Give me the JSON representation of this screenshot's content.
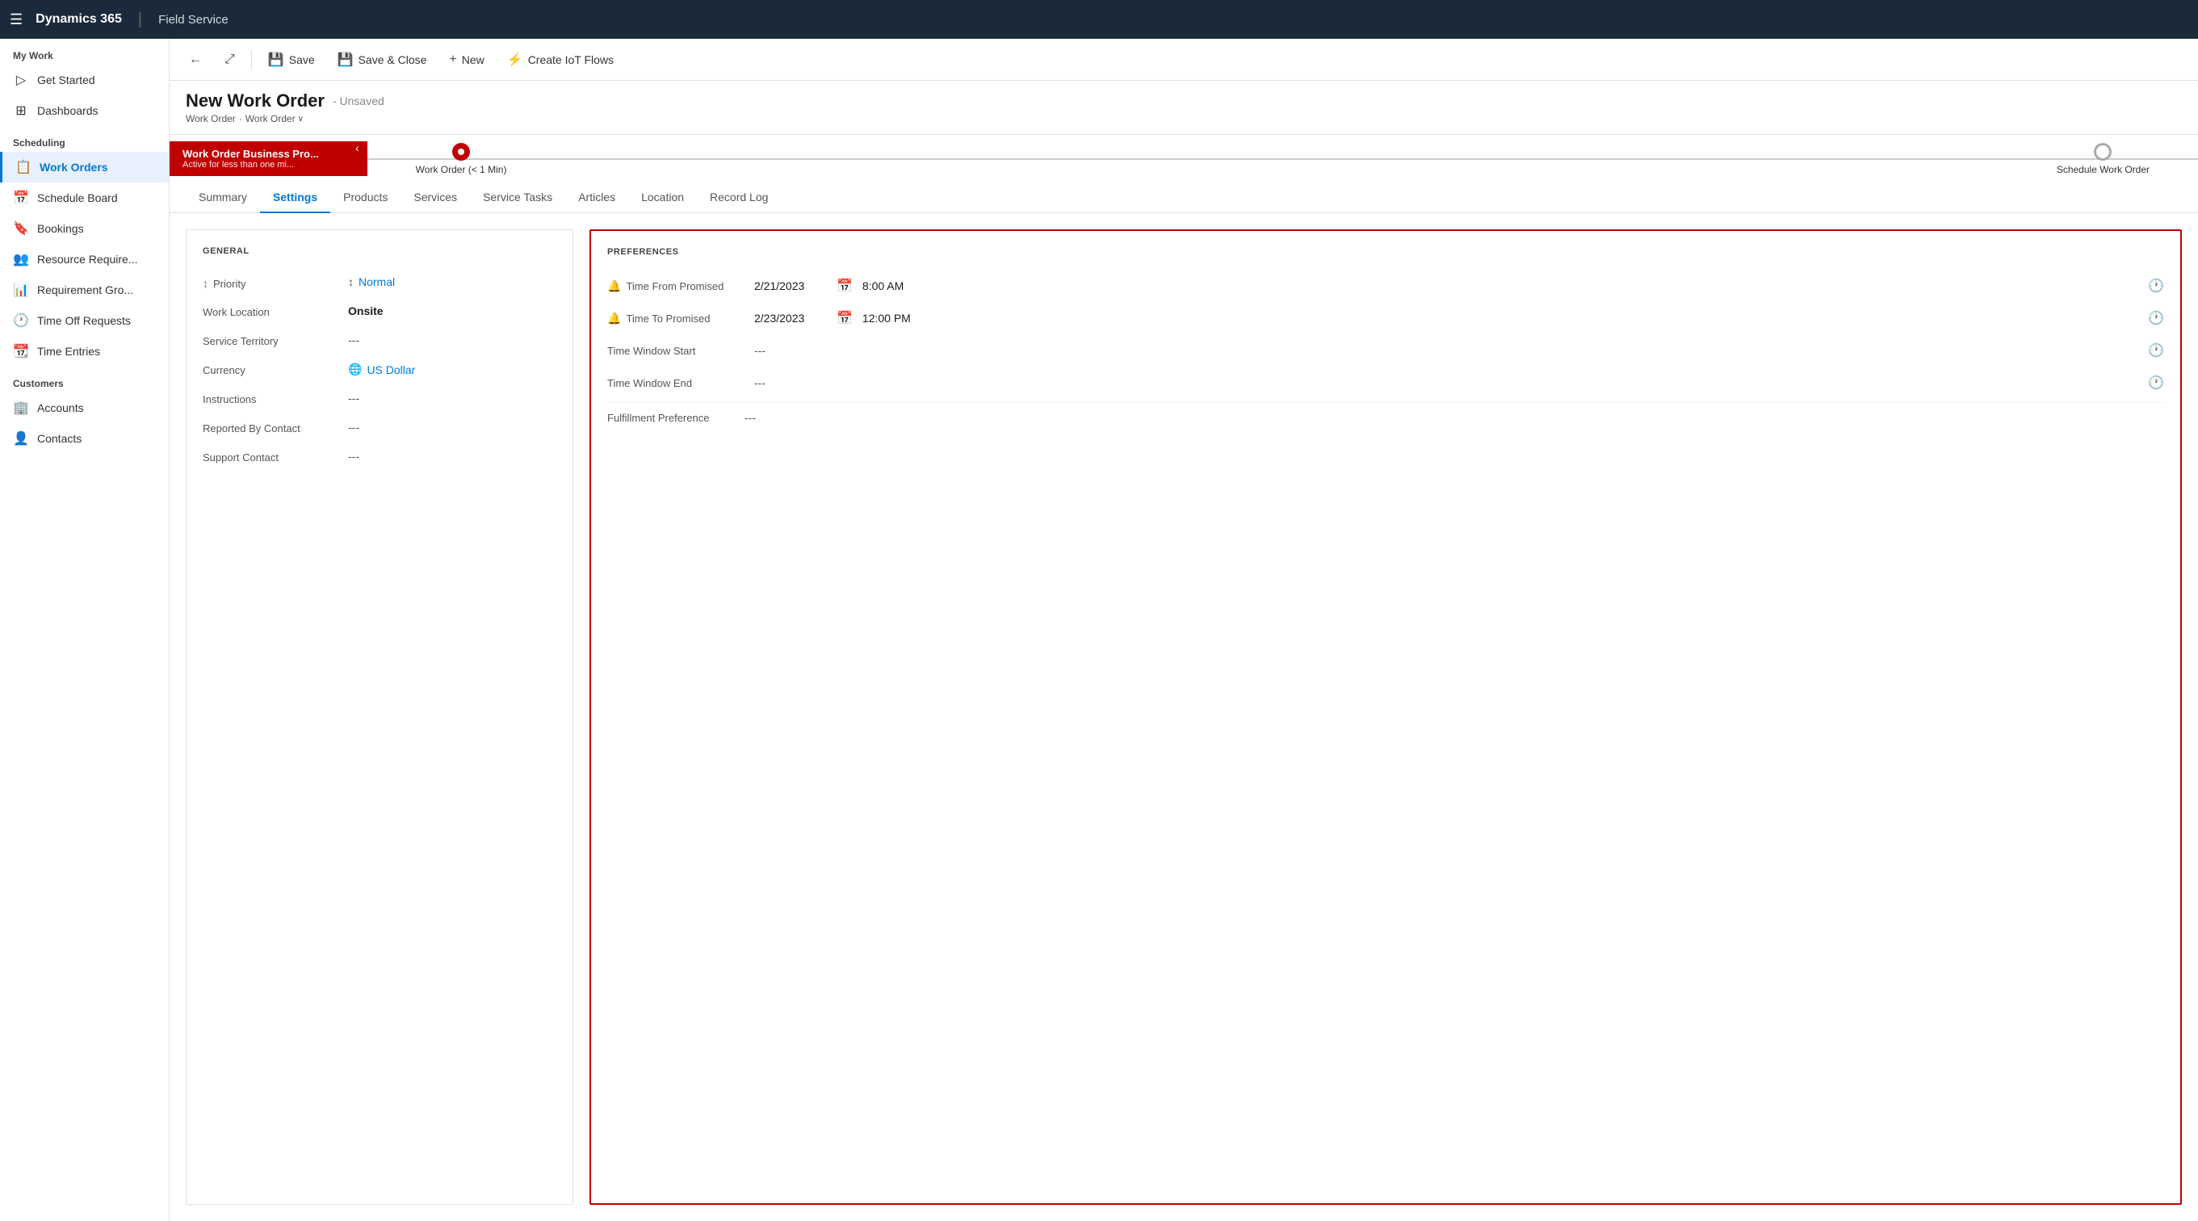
{
  "topNav": {
    "hamburger": "☰",
    "brand": "Dynamics 365",
    "divider": "|",
    "module": "Field Service"
  },
  "sidebar": {
    "myWork": {
      "label": "My Work",
      "items": [
        {
          "id": "get-started",
          "icon": "▷",
          "label": "Get Started"
        },
        {
          "id": "dashboards",
          "icon": "⊞",
          "label": "Dashboards"
        }
      ]
    },
    "scheduling": {
      "label": "Scheduling",
      "items": [
        {
          "id": "work-orders",
          "icon": "📋",
          "label": "Work Orders",
          "active": true
        },
        {
          "id": "schedule-board",
          "icon": "📅",
          "label": "Schedule Board"
        },
        {
          "id": "bookings",
          "icon": "👤",
          "label": "Bookings"
        },
        {
          "id": "resource-require",
          "icon": "👥",
          "label": "Resource Require..."
        },
        {
          "id": "requirement-gro",
          "icon": "📊",
          "label": "Requirement Gro..."
        },
        {
          "id": "time-off-requests",
          "icon": "🕐",
          "label": "Time Off Requests"
        },
        {
          "id": "time-entries",
          "icon": "📆",
          "label": "Time Entries"
        }
      ]
    },
    "customers": {
      "label": "Customers",
      "items": [
        {
          "id": "accounts",
          "icon": "🏢",
          "label": "Accounts"
        },
        {
          "id": "contacts",
          "icon": "👤",
          "label": "Contacts"
        }
      ]
    }
  },
  "commandBar": {
    "back": "←",
    "popout": "⤢",
    "save": {
      "icon": "💾",
      "label": "Save"
    },
    "saveClose": {
      "icon": "💾",
      "label": "Save & Close"
    },
    "new": {
      "icon": "+",
      "label": "New"
    },
    "iotFlows": {
      "icon": "⚡",
      "label": "Create IoT Flows"
    }
  },
  "pageHeader": {
    "title": "New Work Order",
    "unsaved": "- Unsaved",
    "breadcrumb1": "Work Order",
    "breadcrumb2": "Work Order"
  },
  "processBar": {
    "activeStep": {
      "title": "Work Order Business Pro...",
      "subtitle": "Active for less than one mi..."
    },
    "node1": {
      "label": "Work Order (< 1 Min)",
      "active": true
    },
    "node2": {
      "label": "Schedule Work Order",
      "active": false
    }
  },
  "tabs": [
    {
      "id": "summary",
      "label": "Summary",
      "active": false
    },
    {
      "id": "settings",
      "label": "Settings",
      "active": true
    },
    {
      "id": "products",
      "label": "Products",
      "active": false
    },
    {
      "id": "services",
      "label": "Services",
      "active": false
    },
    {
      "id": "service-tasks",
      "label": "Service Tasks",
      "active": false
    },
    {
      "id": "articles",
      "label": "Articles",
      "active": false
    },
    {
      "id": "location",
      "label": "Location",
      "active": false
    },
    {
      "id": "record-log",
      "label": "Record Log",
      "active": false
    }
  ],
  "general": {
    "title": "GENERAL",
    "fields": [
      {
        "id": "priority",
        "icon": "↕",
        "label": "Priority",
        "value": "Normal",
        "type": "link"
      },
      {
        "id": "work-location",
        "label": "Work Location",
        "value": "Onsite",
        "type": "bold"
      },
      {
        "id": "service-territory",
        "label": "Service Territory",
        "value": "---",
        "type": "empty"
      },
      {
        "id": "currency",
        "label": "Currency",
        "value": "US Dollar",
        "type": "currency"
      },
      {
        "id": "instructions",
        "label": "Instructions",
        "value": "---",
        "type": "empty"
      },
      {
        "id": "reported-by-contact",
        "label": "Reported By Contact",
        "value": "---",
        "type": "empty"
      },
      {
        "id": "support-contact",
        "label": "Support Contact",
        "value": "---",
        "type": "empty"
      }
    ]
  },
  "preferences": {
    "title": "PREFERENCES",
    "fields": [
      {
        "id": "time-from-promised",
        "icon": "🔔",
        "label": "Time From Promised",
        "date": "2/21/2023",
        "time": "8:00 AM"
      },
      {
        "id": "time-to-promised",
        "icon": "🔔",
        "label": "Time To Promised",
        "date": "2/23/2023",
        "time": "12:00 PM"
      },
      {
        "id": "time-window-start",
        "label": "Time Window Start",
        "date": "",
        "time": ""
      },
      {
        "id": "time-window-end",
        "label": "Time Window End",
        "date": "",
        "time": ""
      }
    ],
    "fulfillment": {
      "label": "Fulfillment Preference",
      "value": "---"
    }
  }
}
